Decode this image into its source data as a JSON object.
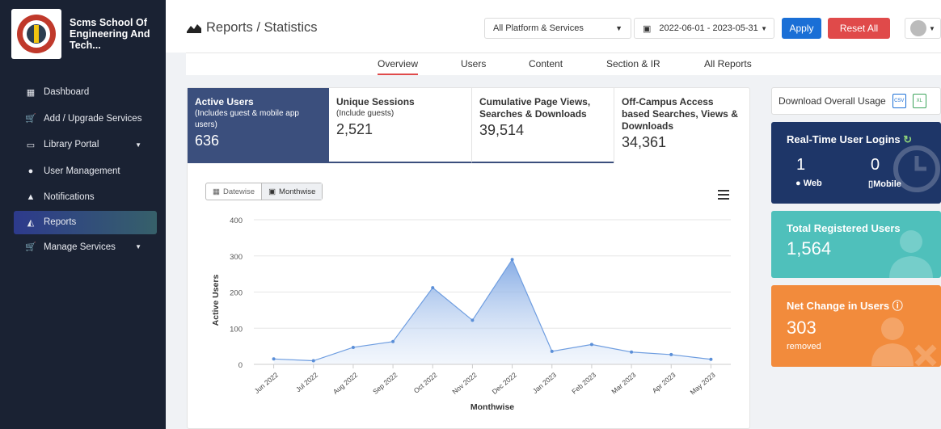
{
  "sidebar": {
    "brand": "Scms School Of Engineering And Tech...",
    "items": [
      {
        "label": "Dashboard",
        "icon": "dashboard-icon"
      },
      {
        "label": "Add / Upgrade Services",
        "icon": "cart-icon"
      },
      {
        "label": "Library Portal",
        "icon": "laptop-icon"
      },
      {
        "label": "User Management",
        "icon": "users-icon"
      },
      {
        "label": "Notifications",
        "icon": "bell-icon"
      },
      {
        "label": "Reports",
        "icon": "area-chart-icon"
      },
      {
        "label": "Manage Services",
        "icon": "cart-plus-icon"
      }
    ]
  },
  "header": {
    "title": "Reports / Statistics",
    "platform_select": "All Platform & Services",
    "date_range": "2022-06-01 - 2023-05-31",
    "apply": "Apply",
    "reset": "Reset All"
  },
  "tabs": [
    "Overview",
    "Users",
    "Content",
    "Section & IR",
    "All Reports"
  ],
  "stats": [
    {
      "title": "Active Users",
      "sub": "(Includes guest & mobile app users)",
      "value": "636"
    },
    {
      "title": "Unique Sessions",
      "sub": "(Include guests)",
      "value": "2,521"
    },
    {
      "title": "Cumulative Page Views, Searches & Downloads",
      "sub": "",
      "value": "39,514"
    },
    {
      "title": "Off-Campus Access based Searches, Views & Downloads",
      "sub": "",
      "value": "34,361"
    }
  ],
  "toggle": {
    "datewise": "Datewise",
    "monthwise": "Monthwise"
  },
  "chart_data": {
    "type": "area",
    "categories": [
      "Jun 2022",
      "Jul 2022",
      "Aug 2022",
      "Sep 2022",
      "Oct 2022",
      "Nov 2022",
      "Dec 2022",
      "Jan 2023",
      "Feb 2023",
      "Mar 2023",
      "Apr 2023",
      "May 2023"
    ],
    "values": [
      15,
      10,
      47,
      63,
      212,
      122,
      290,
      36,
      55,
      34,
      27,
      14
    ],
    "xlabel": "Monthwise",
    "ylabel": "Active Users",
    "ylim": [
      0,
      400
    ],
    "yticks": [
      0,
      100,
      200,
      300,
      400
    ],
    "grid": true
  },
  "right": {
    "download": "Download Overall Usage",
    "realtime": {
      "title": "Real-Time User Logins",
      "web_value": "1",
      "web_label": "Web",
      "mobile_value": "0",
      "mobile_label": "Mobile"
    },
    "registered": {
      "title": "Total Registered Users",
      "value": "1,564"
    },
    "net": {
      "title": "Net Change in Users",
      "value": "303",
      "sub": "removed"
    }
  },
  "colors": {
    "sidebar": "#1a2233",
    "accent": "#3b4f7d",
    "apply": "#1a6fd6",
    "reset": "#e04a4a",
    "teal": "#4fc0bb",
    "orange": "#f28b3c",
    "navy": "#1e3668"
  }
}
